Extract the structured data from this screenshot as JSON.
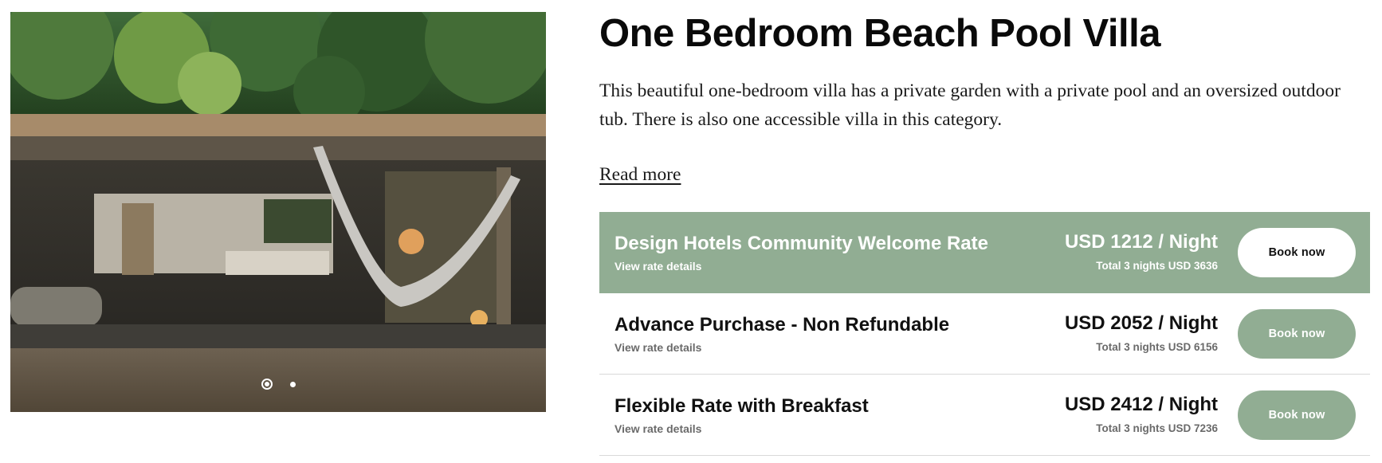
{
  "gallery": {
    "slides": 2,
    "active_slide": 1,
    "image_description": "villa-photo"
  },
  "room": {
    "title": "One Bedroom Beach Pool Villa",
    "description": "This beautiful one-bedroom villa has a private garden with a private pool and an oversized outdoor tub. There is also one accessible villa in this category.",
    "read_more": "Read more"
  },
  "rates": [
    {
      "name": "Design Hotels Community Welcome Rate",
      "details_link": "View rate details",
      "price": "USD 1212 / Night",
      "total": "Total 3 nights USD 3636",
      "button": "Book now",
      "highlighted": true
    },
    {
      "name": "Advance Purchase - Non Refundable",
      "details_link": "View rate details",
      "price": "USD 2052 / Night",
      "total": "Total 3 nights USD 6156",
      "button": "Book now",
      "highlighted": false
    },
    {
      "name": "Flexible Rate with Breakfast",
      "details_link": "View rate details",
      "price": "USD 2412 / Night",
      "total": "Total 3 nights USD 7236",
      "button": "Book now",
      "highlighted": false
    }
  ],
  "colors": {
    "accent_green": "#91ad93",
    "text": "#111111",
    "muted_text": "#6a6a6a"
  }
}
